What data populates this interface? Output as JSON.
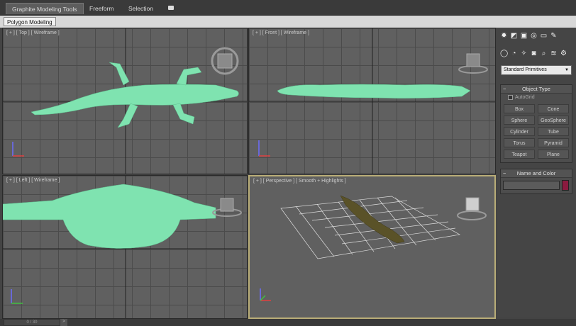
{
  "ribbon": {
    "tabs": [
      {
        "label": "Graphite Modeling Tools"
      },
      {
        "label": "Freeform"
      },
      {
        "label": "Selection"
      }
    ],
    "subtab": "Polygon Modeling"
  },
  "viewports": {
    "top": "[ + ] [ Top ] [ Wireframe ]",
    "front": "[ + ] [ Front ] [ Wireframe ]",
    "left": "[ + ] [ Left ] [ Wireframe ]",
    "perspective": "[ + ] [ Perspective ] [ Smooth + Highlights ]"
  },
  "command_panel": {
    "tab_icons": [
      "create-icon",
      "modify-icon",
      "hierarchy-icon",
      "motion-icon",
      "display-icon",
      "utilities-icon"
    ],
    "sub_icons": [
      "geometry-icon",
      "shapes-icon",
      "lights-icon",
      "cameras-icon",
      "helpers-icon",
      "spacewarps-icon",
      "systems-icon"
    ],
    "dropdown": "Standard Primitives",
    "object_type": {
      "title": "Object Type",
      "autogrid": "AutoGrid",
      "buttons": [
        "Box",
        "Cone",
        "Sphere",
        "GeoSphere",
        "Cylinder",
        "Tube",
        "Torus",
        "Pyramid",
        "Teapot",
        "Plane"
      ]
    },
    "name_and_color": {
      "title": "Name and Color",
      "color": "#8b1a3f"
    }
  },
  "colors": {
    "wireframe": "#7fe3b0",
    "active_border": "#b9ad77",
    "viewport_bg": "#606060"
  },
  "timeline": {
    "frame": "0 / 30"
  }
}
